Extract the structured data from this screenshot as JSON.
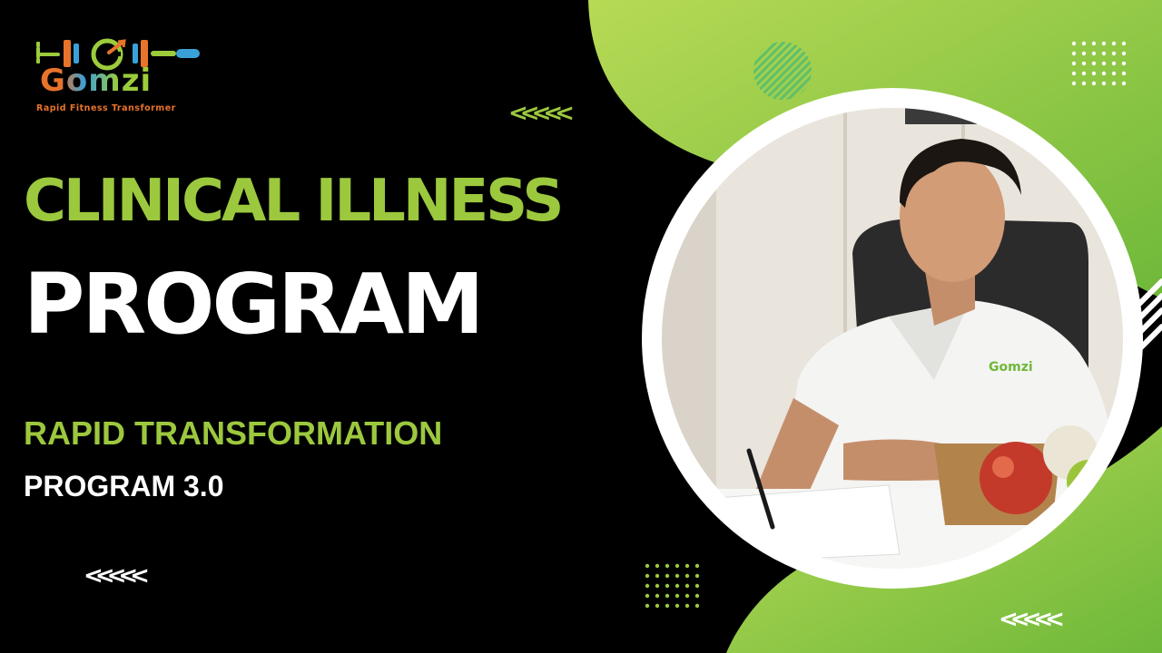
{
  "brand": {
    "name": "Gomzi",
    "tagline": "Rapid Fitness Transformer"
  },
  "headline": {
    "line1": "CLINICAL ILLNESS",
    "line2": "PROGRAM"
  },
  "subheadline": {
    "line1": "RAPID TRANSFORMATION",
    "line2": "PROGRAM 3.0"
  },
  "photo": {
    "shirt_logo": "Gomzi"
  },
  "decor": {
    "chevrons": "<<<<<"
  },
  "colors": {
    "background": "#000000",
    "accent_green": "#9cc83e",
    "white": "#ffffff",
    "brand_orange": "#e8732a",
    "brand_blue": "#3aa0d8"
  }
}
